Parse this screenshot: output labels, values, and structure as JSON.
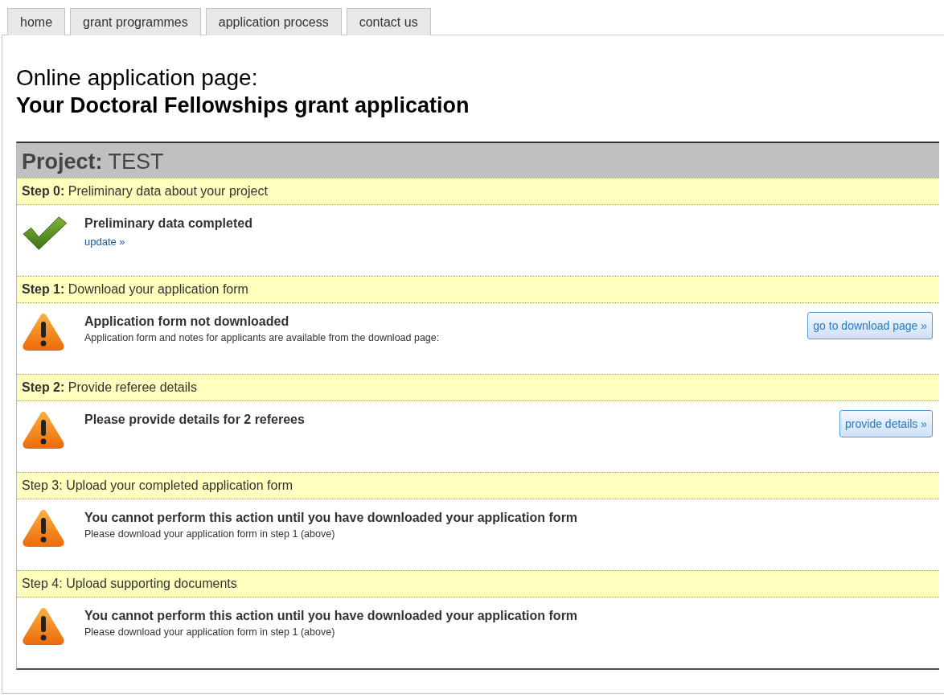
{
  "tabs": [
    {
      "label": "home"
    },
    {
      "label": "grant programmes"
    },
    {
      "label": "application process"
    },
    {
      "label": "contact us"
    }
  ],
  "heading": {
    "line_1": "Online application page:",
    "line_2": "Your Doctoral Fellowships grant application"
  },
  "project": {
    "title": "**Project:** TEST",
    "steps": [
      {
        "header": "**Step 0:** Preliminary data about your project",
        "kind": "check",
        "message": "Preliminary data completed",
        "link": "update »"
      },
      {
        "header": "**Step 1:** Download your application form",
        "kind": "warning",
        "message": "Application form not downloaded",
        "note": "Application form and notes for applicants are available from the download page:",
        "button": "go to download page »"
      },
      {
        "header": "**Step 2:** Provide referee details",
        "kind": "warning",
        "message": "Please provide details for 2 referees",
        "button": "provide details »"
      },
      {
        "header": "Step 3: Upload your completed application form",
        "kind": "warning",
        "message": "You cannot perform this action until you have downloaded your application form",
        "note": "Please download your application form in step 1 (above)"
      },
      {
        "header": "Step 4: Upload supporting documents",
        "kind": "warning",
        "message": "You cannot perform this action until you have downloaded your application form",
        "note": "Please download your application form in step 1 (above)"
      }
    ]
  }
}
